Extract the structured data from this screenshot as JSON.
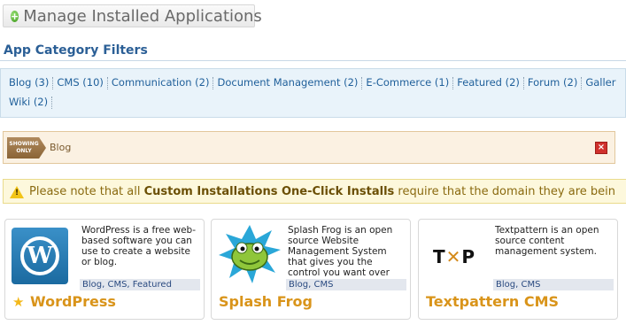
{
  "header": {
    "title": "Manage Installed Applications",
    "icon": "plus-circle-icon"
  },
  "filters": {
    "heading": "App Category Filters",
    "row1": [
      {
        "label": "Blog (3)"
      },
      {
        "label": "CMS (10)"
      },
      {
        "label": "Communication (2)"
      },
      {
        "label": "Document Management (2)"
      },
      {
        "label": "E-Commerce (1)"
      },
      {
        "label": "Featured (2)"
      },
      {
        "label": "Forum (2)"
      },
      {
        "label": "Galler"
      }
    ],
    "row2": [
      {
        "label": "Wiki (2)"
      }
    ]
  },
  "showing": {
    "tag_line1": "SHOWING",
    "tag_line2": "ONLY",
    "label": "Blog",
    "close_symbol": "×"
  },
  "notice": {
    "prefix": "Please note that all ",
    "bold": "Custom Installations One-Click Installs",
    "suffix": " require that the domain they are bein",
    "icon": "warning-icon"
  },
  "apps": [
    {
      "name": "WordPress",
      "description": "WordPress is a free web-based software you can use to create a website or blog.",
      "tags": "Blog, CMS, Featured",
      "featured": true,
      "logo_text": "W"
    },
    {
      "name": "Splash Frog",
      "description": "Splash Frog is an open source Website Management System that gives you the control you want over",
      "tags": "Blog, CMS",
      "featured": false
    },
    {
      "name": "Textpattern CMS",
      "description": "Textpattern is an open source content management system.",
      "tags": "Blog, CMS",
      "featured": false,
      "logo_text_left": "T",
      "logo_text_hammer": "✕",
      "logo_text_right": "P"
    }
  ],
  "colors": {
    "link": "#1f5f9a",
    "heading": "#2b5f96",
    "app_name": "#d9941a",
    "close": "#d0312d"
  }
}
